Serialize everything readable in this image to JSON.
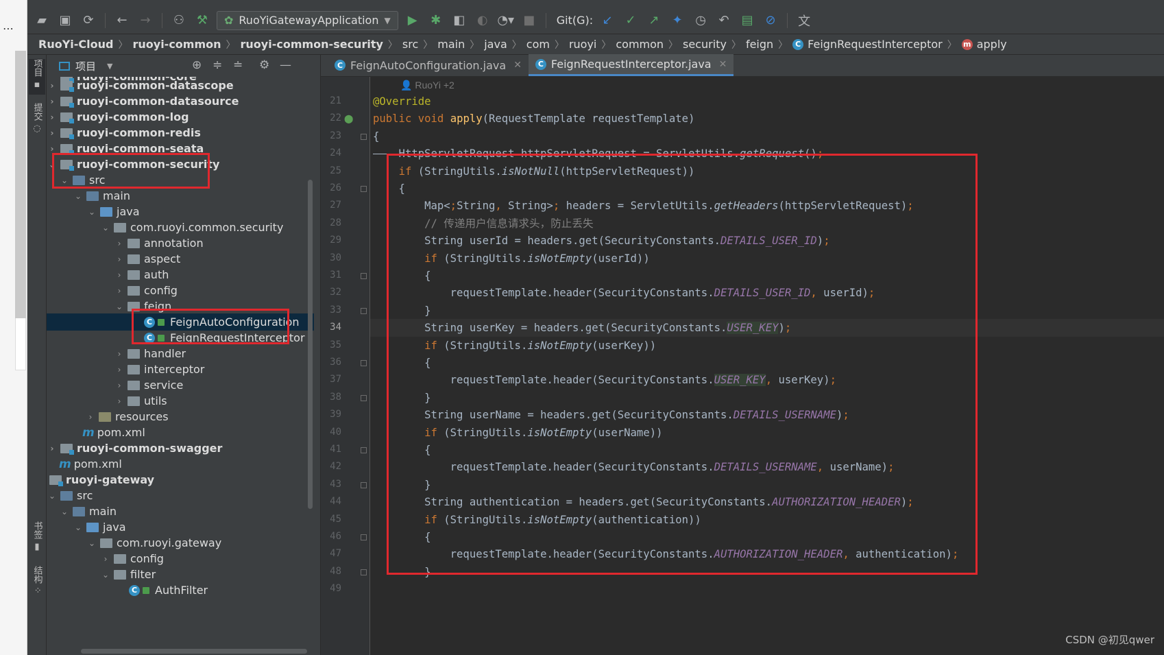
{
  "toolbar": {
    "run_config": "RuoYiGatewayApplication",
    "git_label": "Git(G):"
  },
  "breadcrumb": [
    "RuoYi-Cloud",
    "ruoyi-common",
    "ruoyi-common-security",
    "src",
    "main",
    "java",
    "com",
    "ruoyi",
    "common",
    "security",
    "feign",
    "FeignRequestInterceptor",
    "apply"
  ],
  "stripe": {
    "project": "项目",
    "commit": "提交",
    "bookmarks": "书签",
    "structure": "结构"
  },
  "project_panel": {
    "title": "项目",
    "tree": [
      {
        "label": "ruoyi-common-datascope",
        "bold": true
      },
      {
        "label": "ruoyi-common-datasource",
        "bold": true
      },
      {
        "label": "ruoyi-common-log",
        "bold": true
      },
      {
        "label": "ruoyi-common-redis",
        "bold": true
      },
      {
        "label": "ruoyi-common-seata",
        "bold": true
      },
      {
        "label": "ruoyi-common-security",
        "bold": true
      },
      {
        "label": "src",
        "bold": false
      },
      {
        "label": "main",
        "bold": false
      },
      {
        "label": "java",
        "bold": false
      },
      {
        "label": "com.ruoyi.common.security",
        "bold": false
      },
      {
        "label": "annotation",
        "bold": false
      },
      {
        "label": "aspect",
        "bold": false
      },
      {
        "label": "auth",
        "bold": false
      },
      {
        "label": "config",
        "bold": false
      },
      {
        "label": "feign",
        "bold": false
      },
      {
        "label": "FeignAutoConfiguration",
        "bold": false
      },
      {
        "label": "FeignRequestInterceptor",
        "bold": false
      },
      {
        "label": "handler",
        "bold": false
      },
      {
        "label": "interceptor",
        "bold": false
      },
      {
        "label": "service",
        "bold": false
      },
      {
        "label": "utils",
        "bold": false
      },
      {
        "label": "resources",
        "bold": false
      },
      {
        "label": "pom.xml",
        "bold": false
      },
      {
        "label": "ruoyi-common-swagger",
        "bold": true
      },
      {
        "label": "pom.xml",
        "bold": false
      },
      {
        "label": "ruoyi-gateway",
        "bold": true
      },
      {
        "label": "src",
        "bold": false
      },
      {
        "label": "main",
        "bold": false
      },
      {
        "label": "java",
        "bold": false
      },
      {
        "label": "com.ruoyi.gateway",
        "bold": false
      },
      {
        "label": "config",
        "bold": false
      },
      {
        "label": "filter",
        "bold": false
      },
      {
        "label": "AuthFilter",
        "bold": false
      }
    ]
  },
  "tabs": [
    {
      "label": "FeignAutoConfiguration.java",
      "active": false
    },
    {
      "label": "FeignRequestInterceptor.java",
      "active": true
    }
  ],
  "editor": {
    "author_hint": "RuoYi +2",
    "current_line": 34,
    "line_numbers": [
      "21",
      "22",
      "23",
      "24",
      "25",
      "26",
      "27",
      "28",
      "29",
      "30",
      "31",
      "32",
      "33",
      "34",
      "35",
      "36",
      "37",
      "38",
      "39",
      "40",
      "41",
      "42",
      "43",
      "44",
      "45",
      "46",
      "47",
      "48",
      "49"
    ],
    "lines": [
      "@Override",
      "public void apply(RequestTemplate requestTemplate)",
      "{",
      "    HttpServletRequest httpServletRequest = ServletUtils.getRequest();",
      "    if (StringUtils.isNotNull(httpServletRequest))",
      "    {",
      "        Map<String, String> headers = ServletUtils.getHeaders(httpServletRequest);",
      "        // 传递用户信息请求头，防止丢失",
      "        String userId = headers.get(SecurityConstants.DETAILS_USER_ID);",
      "        if (StringUtils.isNotEmpty(userId))",
      "        {",
      "            requestTemplate.header(SecurityConstants.DETAILS_USER_ID, userId);",
      "        }",
      "        String userKey = headers.get(SecurityConstants.USER_KEY);",
      "        if (StringUtils.isNotEmpty(userKey))",
      "        {",
      "            requestTemplate.header(SecurityConstants.USER_KEY, userKey);",
      "        }",
      "        String userName = headers.get(SecurityConstants.DETAILS_USERNAME);",
      "        if (StringUtils.isNotEmpty(userName))",
      "        {",
      "            requestTemplate.header(SecurityConstants.DETAILS_USERNAME, userName);",
      "        }",
      "        String authentication = headers.get(SecurityConstants.AUTHORIZATION_HEADER);",
      "        if (StringUtils.isNotEmpty(authentication))",
      "        {",
      "            requestTemplate.header(SecurityConstants.AUTHORIZATION_HEADER, authentication);",
      "        }",
      ""
    ]
  },
  "watermark": "CSDN @初见qwer",
  "colors": {
    "keyword": "#cc7832",
    "annotation": "#bbb529",
    "function": "#ffc66d",
    "constant": "#9876aa",
    "highlight_box": "#e0282e"
  }
}
